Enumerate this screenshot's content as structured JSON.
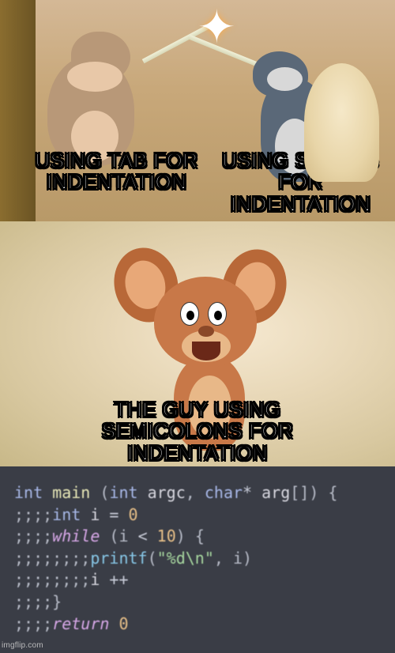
{
  "captions": {
    "left": "Using tab for indentation",
    "right": "Using spaces for indentation",
    "middle": "The guy using semicolons for indentation"
  },
  "code": {
    "l1": {
      "t_int": "int",
      "fn": "main",
      "p1": " (",
      "t_int2": "int",
      "argc": " argc",
      "comma": ",",
      "t_char": " char",
      "star": "*",
      "arg": " arg",
      "brk": "[]) {"
    },
    "l2": {
      "ind": ";;;;",
      "t_int": "int",
      "i": " i",
      "eq": " = ",
      "zero": "0"
    },
    "l3": {
      "ind": ";;;;",
      "kw": "while",
      "open": " (i ",
      "lt": "<",
      "ten": " 10",
      "close": ") {"
    },
    "l4": {
      "ind": ";;;;;;;;",
      "fn": "printf",
      "open": "(",
      "str": "\"%d\\n\"",
      "rest": ", i)"
    },
    "l5": {
      "ind": ";;;;;;;;",
      "i": "i",
      "pp": " ++"
    },
    "l6": {
      "ind": ";;;;",
      "brace": "}"
    },
    "l7": {
      "ind": ";;;;",
      "kw": "return",
      "sp": " ",
      "zero": "0"
    }
  },
  "watermark": "imgflip.com"
}
